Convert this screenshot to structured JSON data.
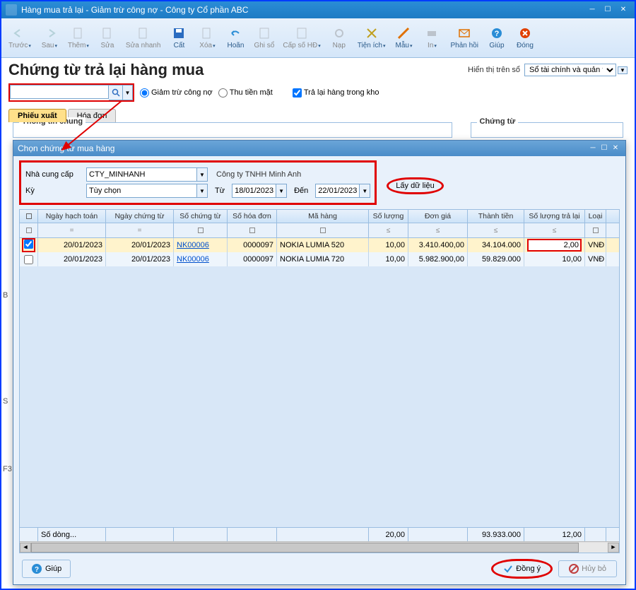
{
  "window": {
    "title": "Hàng mua trả lại - Giảm trừ công nợ - Công ty Cổ phần ABC"
  },
  "toolbar": {
    "prev": "Trước",
    "next": "Sau",
    "add": "Thêm",
    "edit": "Sửa",
    "quickedit": "Sửa nhanh",
    "cut": "Cất",
    "del": "Xóa",
    "undo": "Hoãn",
    "write": "Ghi sổ",
    "numhd": "Cấp số HĐ",
    "load": "Nạp",
    "util": "Tiện ích",
    "tpl": "Mẫu",
    "print": "In",
    "feedback": "Phản hồi",
    "help": "Giúp",
    "close": "Đóng"
  },
  "page": {
    "title": "Chứng từ trả lại hàng mua",
    "display_label": "Hiển thị trên sổ",
    "display_value": "Sổ tài chính và quản trị"
  },
  "options": {
    "radio_debt": "Giảm trừ công nợ",
    "radio_cash": "Thu tiền mặt",
    "chk_stock": "Trả lại hàng trong kho"
  },
  "tabs": {
    "out": "Phiếu xuất",
    "inv": "Hóa đơn"
  },
  "bg": {
    "group1": "Thông tin chung",
    "group2": "Chứng từ"
  },
  "gutter": {
    "b": "B",
    "s": "S",
    "f3": "F3"
  },
  "dialog": {
    "title": "Chọn chứng từ mua hàng",
    "supplier_label": "Nhà cung cấp",
    "supplier_value": "CTY_MINHANH",
    "supplier_name": "Công ty TNHH Minh Anh",
    "period_label": "Kỳ",
    "period_value": "Tùy chọn",
    "from_label": "Từ",
    "from_value": "18/01/2023",
    "to_label": "Đến",
    "to_value": "22/01/2023",
    "fetch": "Lấy dữ liệu",
    "cols": {
      "date1": "Ngày hạch toán",
      "date2": "Ngày chứng từ",
      "sct": "Số chứng từ",
      "shd": "Số hóa đơn",
      "mh": "Mã hàng",
      "sl": "Số lượng",
      "dg": "Đơn giá",
      "tt": "Thành tiền",
      "sltl": "Số lượng trả lại",
      "loai": "Loại"
    },
    "rows": [
      {
        "chk": true,
        "date1": "20/01/2023",
        "date2": "20/01/2023",
        "sct": "NK00006",
        "shd": "0000097",
        "mh": "NOKIA LUMIA 520",
        "sl": "10,00",
        "dg": "3.410.400,00",
        "tt": "34.104.000",
        "sltl": "2,00",
        "loai": "VNĐ"
      },
      {
        "chk": false,
        "date1": "20/01/2023",
        "date2": "20/01/2023",
        "sct": "NK00006",
        "shd": "0000097",
        "mh": "NOKIA LUMIA 720",
        "sl": "10,00",
        "dg": "5.982.900,00",
        "tt": "59.829.000",
        "sltl": "10,00",
        "loai": "VNĐ"
      }
    ],
    "footer": {
      "rowcount": "Số dòng...",
      "sum_sl": "20,00",
      "sum_tt": "93.933.000",
      "sum_sltl": "12,00"
    },
    "help": "Giúp",
    "ok": "Đồng ý",
    "cancel": "Hủy bỏ"
  }
}
